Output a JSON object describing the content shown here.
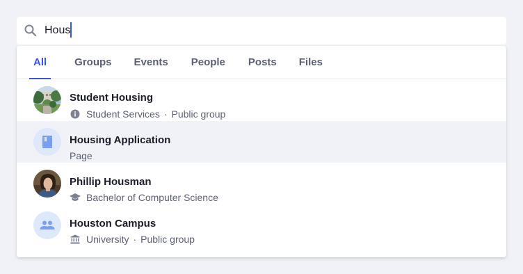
{
  "search": {
    "value": "Hous",
    "icon": "search-icon"
  },
  "tabs": [
    {
      "label": "All",
      "active": true
    },
    {
      "label": "Groups",
      "active": false
    },
    {
      "label": "Events",
      "active": false
    },
    {
      "label": "People",
      "active": false
    },
    {
      "label": "Posts",
      "active": false
    },
    {
      "label": "Files",
      "active": false
    }
  ],
  "results": [
    {
      "title": "Student Housing",
      "meta_icon": "info-icon",
      "meta_parts": [
        "Student Services",
        "Public group"
      ],
      "avatar": "campus-photo",
      "separator": "·"
    },
    {
      "title": "Housing Application",
      "meta_parts": [
        "Page"
      ],
      "avatar": "book-icon",
      "highlighted": true
    },
    {
      "title": "Phillip Housman",
      "meta_icon": "graduation-cap-icon",
      "meta_parts": [
        "Bachelor of Computer Science"
      ],
      "avatar": "person-photo"
    },
    {
      "title": "Houston Campus",
      "meta_icon": "institution-icon",
      "meta_parts": [
        "University",
        "Public group"
      ],
      "avatar": "group-icon",
      "separator": "·"
    }
  ],
  "colors": {
    "accent": "#3c55d6",
    "icon_bg": "#dde8fb",
    "icon_fg": "#7a9ef0",
    "highlight_row": "#f1f2f7",
    "background": "#f1f2f7"
  }
}
